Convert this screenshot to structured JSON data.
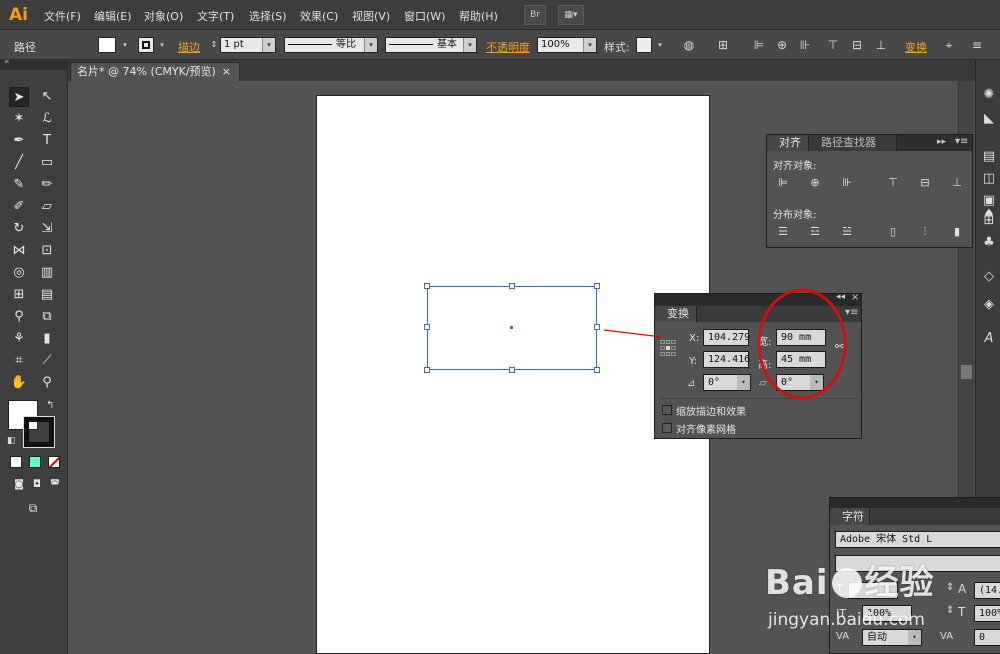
{
  "app": {
    "logo": "Ai"
  },
  "menu": {
    "items": [
      "文件(F)",
      "编辑(E)",
      "对象(O)",
      "文字(T)",
      "选择(S)",
      "效果(C)",
      "视图(V)",
      "窗口(W)",
      "帮助(H)"
    ]
  },
  "menubar_buttons": {
    "bridge": "Br"
  },
  "control": {
    "path_label": "路径",
    "stroke_label": "描边",
    "stroke_weight": "1 pt",
    "profile_1": "等比",
    "profile_2": "基本",
    "opacity_label": "不透明度",
    "opacity_value": "100%",
    "style_label": "样式:",
    "transform_label": "变换"
  },
  "document": {
    "tab_label": "名片* @ 74% (CMYK/预览)",
    "close": "×"
  },
  "align_panel": {
    "tab_align": "对齐",
    "tab_pathfinder": "路径查找器",
    "align_objects_label": "对齐对象:",
    "distribute_objects_label": "分布对象:"
  },
  "transform_panel": {
    "tab": "变换",
    "x_label": "X:",
    "x_value": "104.279",
    "y_label": "Y:",
    "y_value": "124.416",
    "w_label": "宽:",
    "w_value": "90 mm",
    "h_label": "高:",
    "h_value": "45 mm",
    "rotate_value": "0°",
    "shear_value": "0°",
    "scale_strokes": "缩放描边和效果",
    "align_pixel": "对齐像素网格"
  },
  "character_panel": {
    "tab": "字符",
    "font_family": "Adobe 宋体 Std L",
    "font_size": "(14.",
    "leading": "100%",
    "tracking_value": "100%",
    "kerning": "自动",
    "tracking": "0"
  },
  "watermark": {
    "text": "Bai 经验",
    "url": "jingyan.baidu.com"
  },
  "colors": {
    "accent_orange": "#f0a030",
    "annotation_red": "#cc1111",
    "selection_blue": "#3b6db3"
  }
}
